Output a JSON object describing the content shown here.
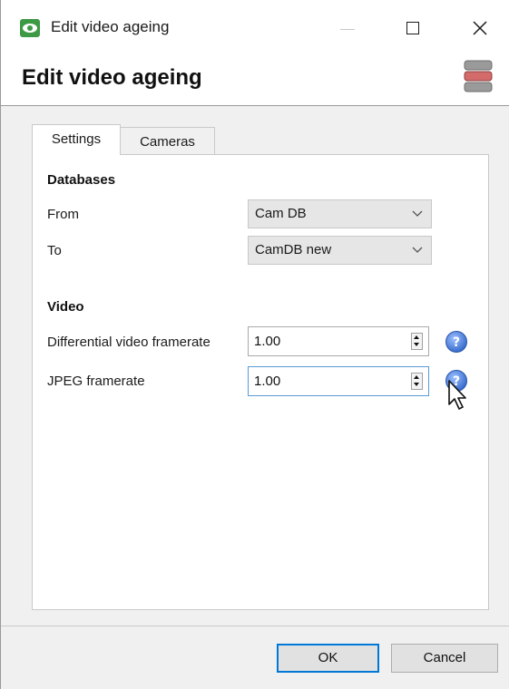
{
  "window": {
    "title": "Edit video ageing",
    "header_title": "Edit video ageing",
    "icons": {
      "app": "eye-icon",
      "header": "database-icon"
    }
  },
  "tabs": [
    {
      "label": "Settings",
      "selected": true
    },
    {
      "label": "Cameras",
      "selected": false
    }
  ],
  "databases": {
    "heading": "Databases",
    "from": {
      "label": "From",
      "value": "Cam DB"
    },
    "to": {
      "label": "To",
      "value": "CamDB new"
    }
  },
  "video": {
    "heading": "Video",
    "differential": {
      "label": "Differential video framerate",
      "value": "1.00"
    },
    "jpeg": {
      "label": "JPEG framerate",
      "value": "1.00"
    }
  },
  "buttons": {
    "ok": "OK",
    "cancel": "Cancel"
  },
  "colors": {
    "accent": "#0078d7",
    "help": "#4a7fd4",
    "app_icon": "#3c9a45"
  }
}
